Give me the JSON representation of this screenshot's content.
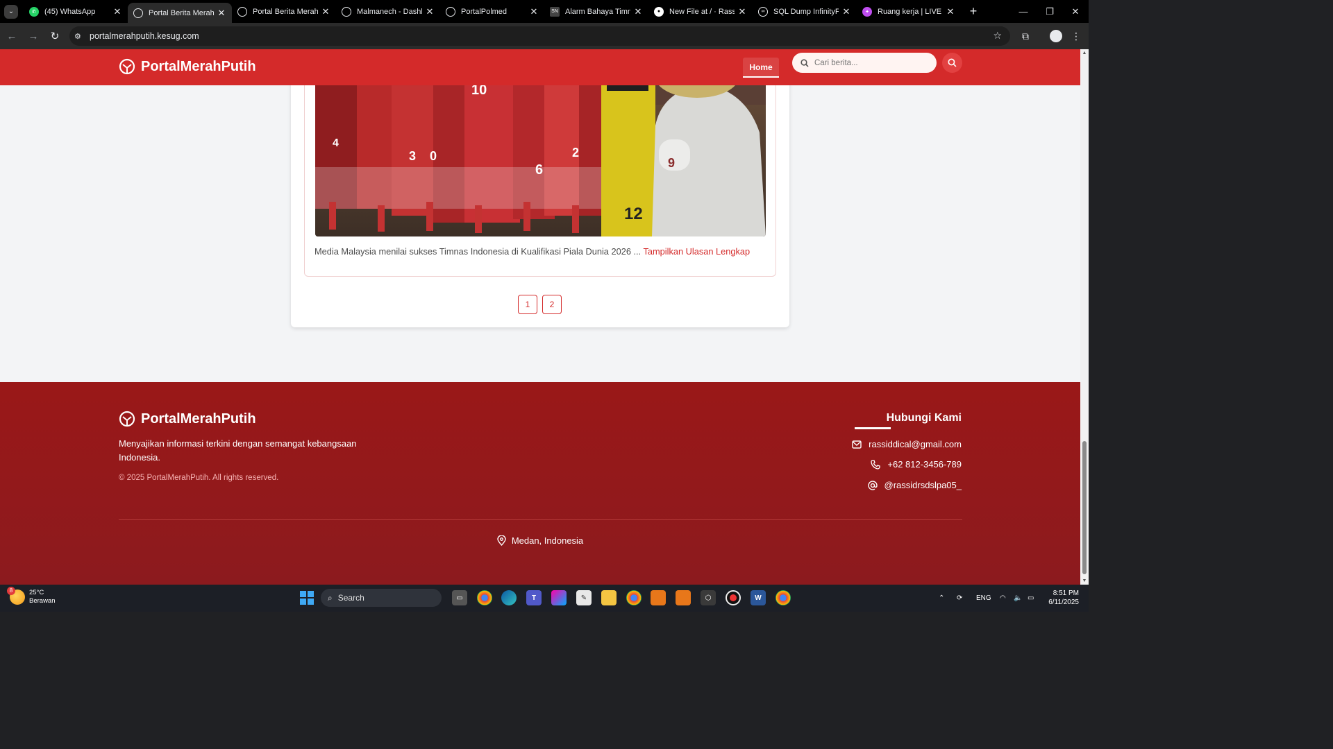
{
  "browser": {
    "tabs": [
      {
        "title": "(45) WhatsApp",
        "active": false,
        "icon": "whatsapp-icon"
      },
      {
        "title": "Portal Berita Merah P",
        "active": true,
        "icon": "globe-icon"
      },
      {
        "title": "Portal Berita Merah P",
        "active": false,
        "icon": "globe-icon"
      },
      {
        "title": "Malmanech - Dashbo",
        "active": false,
        "icon": "globe-icon"
      },
      {
        "title": "PortalPolmed",
        "active": false,
        "icon": "globe-icon"
      },
      {
        "title": "Alarm Bahaya Timna",
        "active": false,
        "icon": "sn-icon"
      },
      {
        "title": "New File at / · Rassid",
        "active": false,
        "icon": "github-icon"
      },
      {
        "title": "SQL Dump InfinityFre",
        "active": false,
        "icon": "infinity-icon"
      },
      {
        "title": "Ruang kerja | LIVE Ba",
        "active": false,
        "icon": "canva-icon"
      }
    ],
    "url": "portalmerahputih.kesug.com"
  },
  "site": {
    "brand": "PortalMerahPutih",
    "nav_home": "Home",
    "search_placeholder": "Cari berita...",
    "accent": "#d42a2a"
  },
  "article": {
    "excerpt": "Media Malaysia menilai sukses Timnas Indonesia di Kualifikasi Piala Dunia 2026 ...",
    "read_more": "Tampilkan Ulasan Lengkap"
  },
  "pagination": [
    "1",
    "2"
  ],
  "footer": {
    "brand": "PortalMerahPutih",
    "tagline": "Menyajikan informasi terkini dengan semangat kebangsaan Indonesia.",
    "copyright": "© 2025 PortalMerahPutih. All rights reserved.",
    "contact_title": "Hubungi Kami",
    "email": "rassiddical@gmail.com",
    "phone": "+62 812-3456-789",
    "social": "@rassidrsdslpa05_",
    "location": "Medan, Indonesia"
  },
  "taskbar": {
    "weather_temp": "25°C",
    "weather_desc": "Berawan",
    "weather_badge": "8",
    "search_label": "Search",
    "lang": "ENG",
    "time": "8:51 PM",
    "date": "6/11/2025"
  }
}
